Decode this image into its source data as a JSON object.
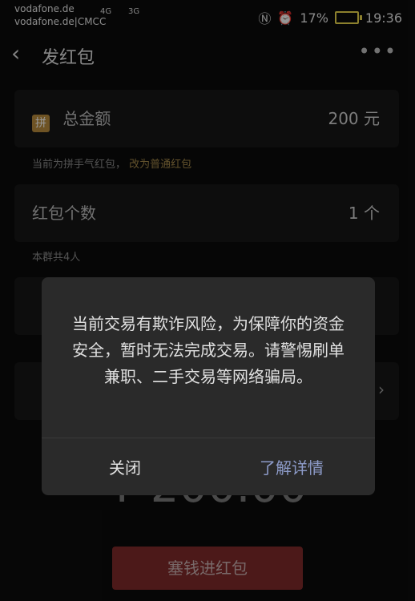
{
  "status_bar": {
    "carrier_top": "vodafone.de",
    "carrier_bottom": "vodafone.de|CMCC",
    "network1": "4G",
    "network2": "3G",
    "battery": "17%",
    "time": "19:36",
    "battery_color": "#e9d64c"
  },
  "header": {
    "back_icon": "chevron-left-icon",
    "title": "发红包",
    "more_icon": "more-icon"
  },
  "form": {
    "total_amount": {
      "badge": "拼",
      "label": "总金额",
      "value": "200 元"
    },
    "note_prefix": "当前为拼手气红包，",
    "note_link": "改为普通红包",
    "packet_count": {
      "label": "红包个数",
      "value": "1 个"
    },
    "group_note": "本群共4人"
  },
  "amount_display": "¥ 200.00",
  "submit_button": "塞钱进红包",
  "dialog": {
    "message": "当前交易有欺诈风险，为保障你的资金安全，暂时无法完成交易。请警惕刷单兼职、二手交易等网络骗局。",
    "close_label": "关闭",
    "detail_label": "了解详情",
    "detail_color": "#8d9bc9"
  }
}
